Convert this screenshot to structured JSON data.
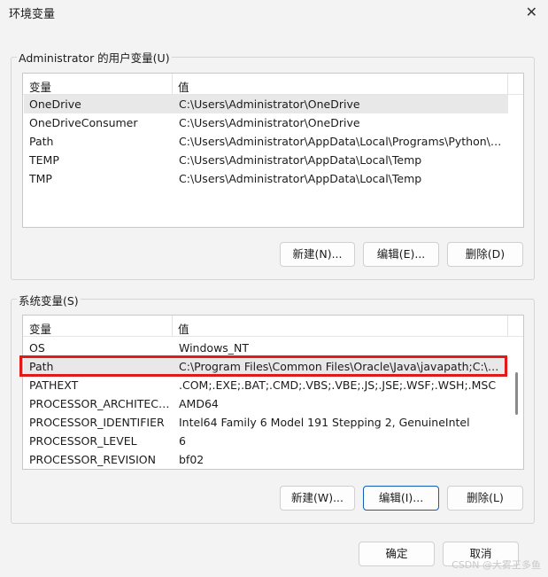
{
  "window": {
    "title": "环境变量",
    "close_icon": "close-icon"
  },
  "user_vars": {
    "group_label": "Administrator 的用户变量(U)",
    "columns": [
      "变量",
      "值"
    ],
    "rows": [
      [
        "OneDrive",
        "C:\\Users\\Administrator\\OneDrive"
      ],
      [
        "OneDriveConsumer",
        "C:\\Users\\Administrator\\OneDrive"
      ],
      [
        "Path",
        "C:\\Users\\Administrator\\AppData\\Local\\Programs\\Python\\Pyt..."
      ],
      [
        "TEMP",
        "C:\\Users\\Administrator\\AppData\\Local\\Temp"
      ],
      [
        "TMP",
        "C:\\Users\\Administrator\\AppData\\Local\\Temp"
      ]
    ],
    "buttons": {
      "new": "新建(N)...",
      "edit": "编辑(E)...",
      "delete": "删除(D)"
    }
  },
  "system_vars": {
    "group_label": "系统变量(S)",
    "columns": [
      "变量",
      "值"
    ],
    "rows": [
      [
        "OS",
        "Windows_NT"
      ],
      [
        "Path",
        "C:\\Program Files\\Common Files\\Oracle\\Java\\javapath;C:\\Prog..."
      ],
      [
        "PATHEXT",
        ".COM;.EXE;.BAT;.CMD;.VBS;.VBE;.JS;.JSE;.WSF;.WSH;.MSC"
      ],
      [
        "PROCESSOR_ARCHITECT...",
        "AMD64"
      ],
      [
        "PROCESSOR_IDENTIFIER",
        "Intel64 Family 6 Model 191 Stepping 2, GenuineIntel"
      ],
      [
        "PROCESSOR_LEVEL",
        "6"
      ],
      [
        "PROCESSOR_REVISION",
        "bf02"
      ]
    ],
    "buttons": {
      "new": "新建(W)...",
      "edit": "编辑(I)...",
      "delete": "删除(L)"
    }
  },
  "footer": {
    "ok": "确定",
    "cancel": "取消"
  },
  "watermark": "CSDN @大雾王多鱼",
  "colors": {
    "highlight": "#e01919",
    "focus": "#0f5fb8"
  }
}
